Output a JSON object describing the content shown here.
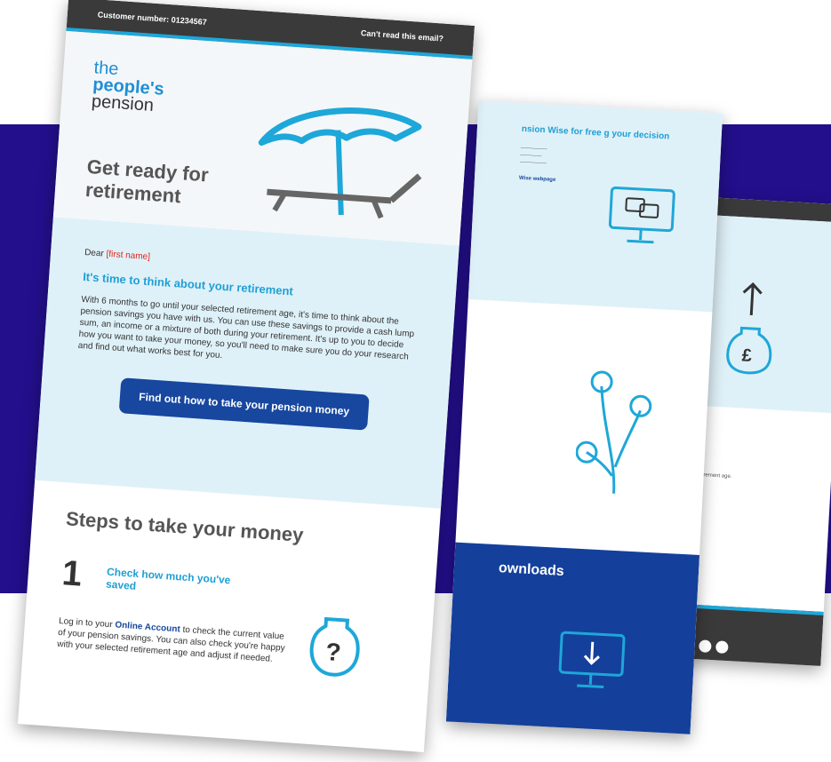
{
  "front": {
    "customer_number": "Customer number: 01234567",
    "cant_read": "Can't read this email?",
    "logo": [
      "the",
      "people's",
      "pension"
    ],
    "hero_title": "Get ready for retirement",
    "dear": "Dear",
    "first_name_placeholder": "[first name]",
    "heading": "It's time to think about your retirement",
    "body": "With 6 months to go until your selected retirement age, it's time to think about the pension savings you have with us. You can use these savings to provide a cash lump sum, an income or a mixture of both during your retirement. It's up to you to decide how you want to take your money, so you'll need to make sure you do your research and find out what works best for you.",
    "cta": "Find out how to take your pension money",
    "steps_title": "Steps to take your money",
    "step1_number": "1",
    "step1_title": "Check how much you've saved",
    "step1_text_a": "Log in to your",
    "step1_link": "Online Account",
    "step1_text_b": "to check the current value of your pension savings. You can also check you're happy with your selected retirement age and adjust if needed."
  },
  "back1": {
    "heading": "nsion Wise for free g your decision",
    "downloads": "ownloads",
    "webpage_link": "Wise webpage"
  },
  "back2": {
    "note": "selected retirement age."
  },
  "colors": {
    "band": "#230f8c",
    "accent": "#1ea7d9",
    "cta": "#17479e"
  }
}
